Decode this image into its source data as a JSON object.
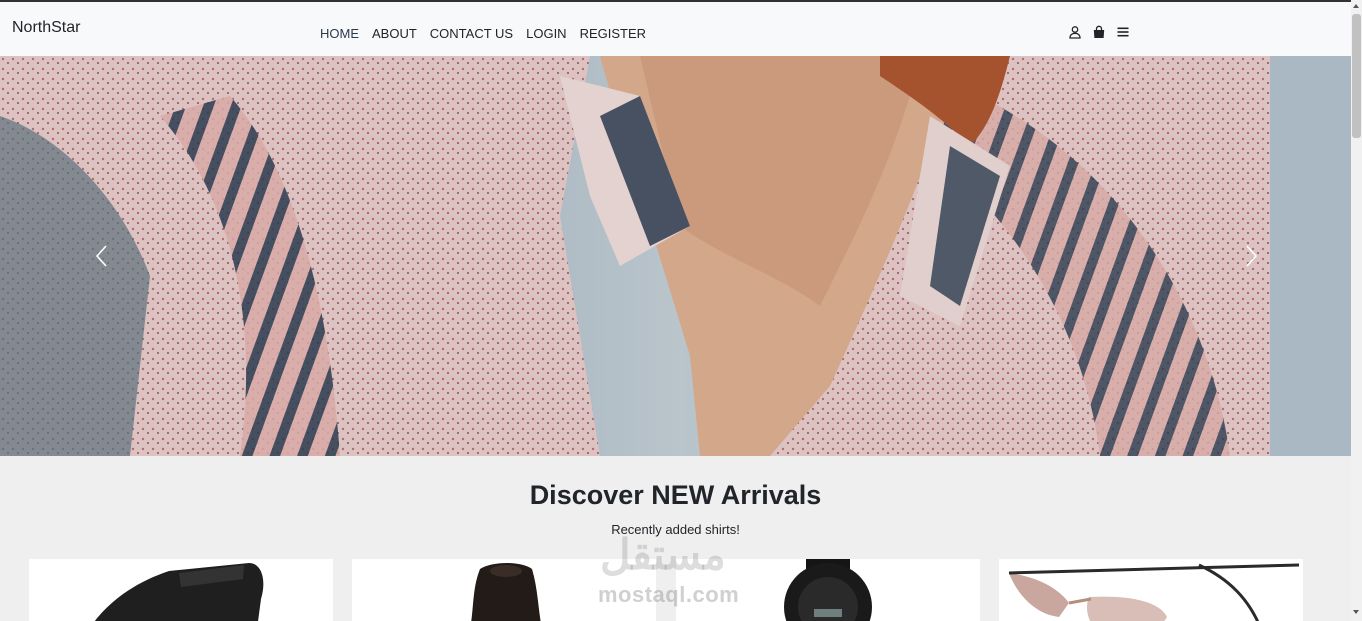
{
  "brand": "NorthStar",
  "nav": {
    "links": [
      {
        "label": "HOME",
        "active": true
      },
      {
        "label": "ABOUT"
      },
      {
        "label": "CONTACT US"
      },
      {
        "label": "LOGIN"
      },
      {
        "label": "REGISTER"
      }
    ],
    "icons": [
      "user-icon",
      "shopping-bag-icon",
      "hamburger-menu-icon"
    ]
  },
  "hero": {
    "image": "woman-in-patterned-shirt-photo",
    "prev_icon": "chevron-left-icon",
    "next_icon": "chevron-right-icon"
  },
  "arrivals": {
    "title": "Discover NEW Arrivals",
    "subtitle": "Recently added shirts!",
    "products": [
      {
        "image": "black-belt-photo"
      },
      {
        "image": "black-scarf-photo"
      },
      {
        "image": "black-digital-watch-photo"
      },
      {
        "image": "pink-sunglasses-photo"
      }
    ]
  },
  "watermark": {
    "latin": "mostaql.com",
    "arabic": "مستقل"
  },
  "colors": {
    "navbar_bg": "#f8f9fa",
    "page_bg": "#efefef",
    "text": "#212529"
  }
}
